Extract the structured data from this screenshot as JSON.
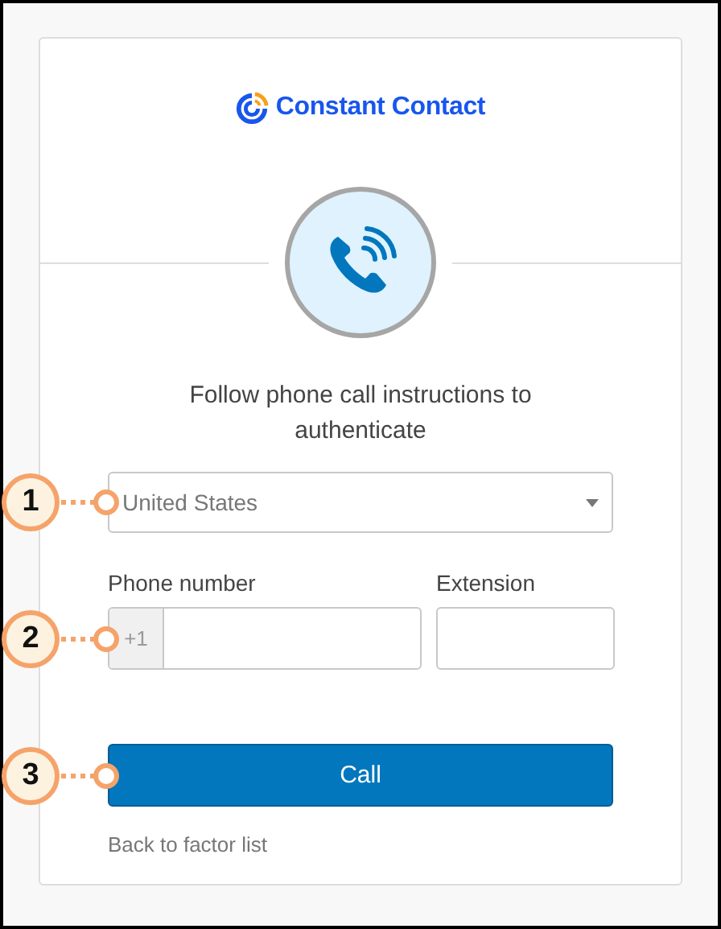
{
  "brand": {
    "name": "Constant Contact"
  },
  "heading": "Follow phone call instructions to authenticate",
  "country_select": {
    "value": "United States",
    "callout": "1"
  },
  "phone": {
    "label": "Phone number",
    "prefix": "+1",
    "callout": "2"
  },
  "extension": {
    "label": "Extension"
  },
  "call_button": {
    "label": "Call",
    "callout": "3"
  },
  "back_link": "Back to factor list"
}
